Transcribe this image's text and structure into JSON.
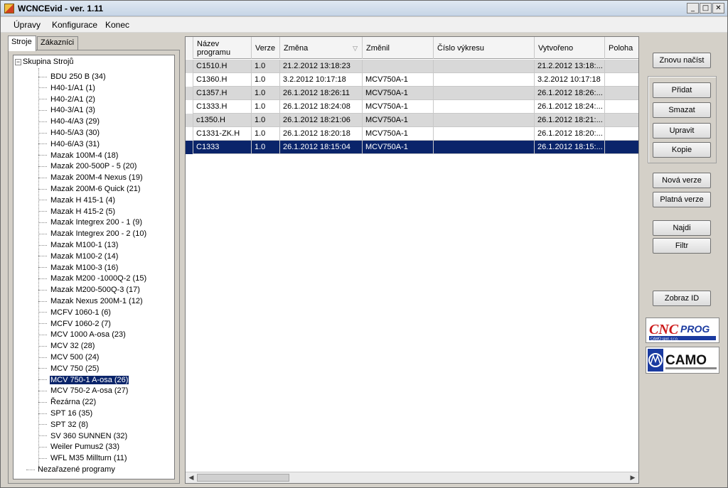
{
  "window": {
    "title": "WCNCEvid - ver. 1.11",
    "buttons": [
      "_",
      "□",
      "✕"
    ]
  },
  "menu": [
    "Úpravy",
    "Konfigurace",
    "Konec"
  ],
  "tabs": [
    "Stroje",
    "Zákazníci"
  ],
  "tree": {
    "root": "Skupina Strojů",
    "items": [
      "BDU 250 B  (34)",
      "H40-1/A1  (1)",
      "H40-2/A1  (2)",
      "H40-3/A1  (3)",
      "H40-4/A3  (29)",
      "H40-5/A3  (30)",
      "H40-6/A3  (31)",
      "Mazak 100M-4  (18)",
      "Mazak 200-500P - 5  (20)",
      "Mazak 200M-4 Nexus  (19)",
      "Mazak 200M-6 Quick  (21)",
      "Mazak H 415-1  (4)",
      "Mazak H 415-2  (5)",
      "Mazak Integrex 200 - 1  (9)",
      "Mazak Integrex 200 - 2  (10)",
      "Mazak M100-1  (13)",
      "Mazak M100-2  (14)",
      "Mazak M100-3  (16)",
      "Mazak M200 -1000Q-2  (15)",
      "Mazak M200-500Q-3  (17)",
      "Mazak Nexus 200M-1  (12)",
      "MCFV 1060-1  (6)",
      "MCFV 1060-2  (7)",
      "MCV 1000 A-osa  (23)",
      "MCV 32  (28)",
      "MCV 500  (24)",
      "MCV 750  (25)",
      "MCV 750-1 A-osa  (26)",
      "MCV 750-2 A-osa  (27)",
      "Řezárna  (22)",
      "SPT 16  (35)",
      "SPT 32  (8)",
      "SV 360 SUNNEN  (32)",
      "Weiler Pumus2  (33)",
      "WFL M35 Millturn  (11)"
    ],
    "selected_index": 27,
    "unassigned": "Nezařazené programy"
  },
  "grid": {
    "columns": [
      "Název programu",
      "Verze",
      "Změna",
      "Změnil",
      "Číslo výkresu",
      "Vytvořeno",
      "Poloha"
    ],
    "sort_column": "Změna",
    "rows": [
      [
        "C1510.H",
        "1.0",
        "21.2.2012 13:18:23",
        "",
        "",
        "21.2.2012 13:18:..."
      ],
      [
        "C1360.H",
        "1.0",
        "3.2.2012 10:17:18",
        "MCV750A-1",
        "",
        "3.2.2012 10:17:18"
      ],
      [
        "C1357.H",
        "1.0",
        "26.1.2012 18:26:11",
        "MCV750A-1",
        "",
        "26.1.2012 18:26:..."
      ],
      [
        "C1333.H",
        "1.0",
        "26.1.2012 18:24:08",
        "MCV750A-1",
        "",
        "26.1.2012 18:24:..."
      ],
      [
        "c1350.H",
        "1.0",
        "26.1.2012 18:21:06",
        "MCV750A-1",
        "",
        "26.1.2012 18:21:..."
      ],
      [
        "C1331-ZK.H",
        "1.0",
        "26.1.2012 18:20:18",
        "MCV750A-1",
        "",
        "26.1.2012 18:20:..."
      ],
      [
        "C1333",
        "1.0",
        "26.1.2012 18:15:04",
        "MCV750A-1",
        "",
        "26.1.2012 18:15:..."
      ]
    ],
    "selected_row": 6
  },
  "buttons": {
    "reload": "Znovu načíst",
    "add": "Přidat",
    "delete": "Smazat",
    "edit": "Upravit",
    "copy": "Kopie",
    "new_version": "Nová verze",
    "valid_version": "Platná verze",
    "find": "Najdi",
    "filter": "Filtr",
    "show_id": "Zobraz ID"
  },
  "logos": {
    "cncprog": "CNC PROG",
    "cncprog_sub": "CAMO spol. s r.o.",
    "camo": "CAMO"
  },
  "colors": {
    "selection": "#0a246a",
    "alt_row": "#d8d8d8",
    "logo_red": "#cc1a1a",
    "logo_blue": "#1a3aa0"
  }
}
